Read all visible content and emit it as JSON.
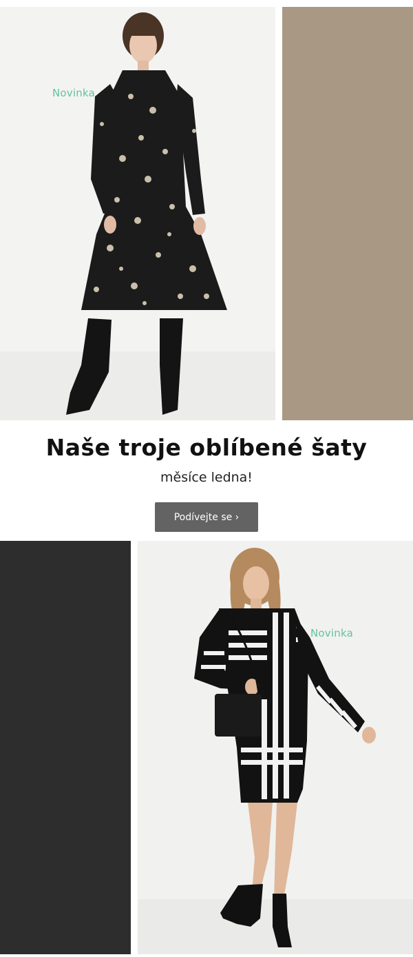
{
  "colors": {
    "badge": "#5ec4a1",
    "swatch_taupe": "#a99984",
    "swatch_charcoal": "#2d2d2d",
    "button_bg": "#636363"
  },
  "product_top": {
    "badge": "Novinka",
    "swatch_color_name": "taupe"
  },
  "promo": {
    "headline": "Naše troje oblíbené šaty",
    "subline": "měsíce ledna!",
    "button_label": "Podívejte se ›"
  },
  "product_bottom": {
    "badge": "Novinka",
    "swatch_color_name": "charcoal"
  }
}
